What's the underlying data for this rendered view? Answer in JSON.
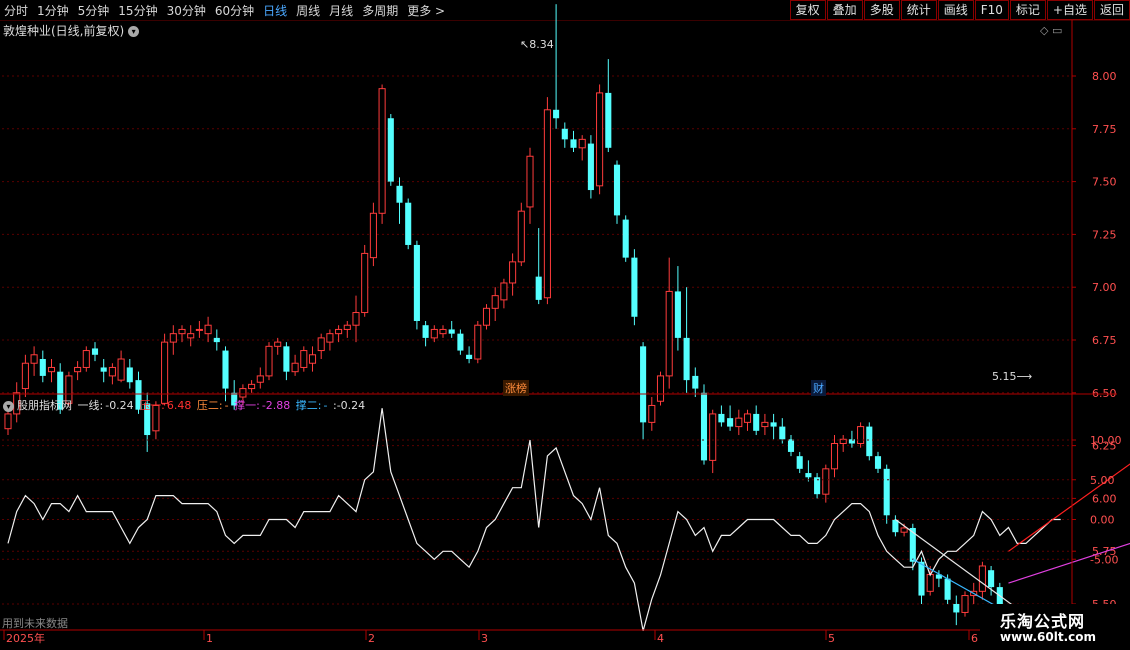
{
  "toolbar": {
    "periods": [
      "分时",
      "1分钟",
      "5分钟",
      "15分钟",
      "30分钟",
      "60分钟",
      "日线",
      "周线",
      "月线",
      "多周期",
      "更多 >"
    ],
    "active_period": "日线",
    "buttons": [
      "复权",
      "叠加",
      "多股",
      "统计",
      "画线",
      "F10",
      "标记",
      "+自选",
      "返回"
    ]
  },
  "main_chart": {
    "title": "敦煌种业(日线,前复权)",
    "high_marker": "8.34",
    "low_marker": "5.15",
    "badge_zhangbang": "涨榜",
    "badge_cai": "财",
    "y_ticks": [
      "8.00",
      "7.75",
      "7.50",
      "7.25",
      "7.00",
      "6.75",
      "6.50",
      "6.25",
      "6.00",
      "5.75",
      "5.50"
    ]
  },
  "indicator": {
    "name": "股朋指标网",
    "line1_label": "一线:",
    "line1_value": "-0.24",
    "ya1_label": "压一:",
    "ya1_value": "6.48",
    "ya2_label": "压二:",
    "ya2_value": "-",
    "cheng1_label": "撑一:",
    "cheng1_value": "-2.88",
    "cheng2_label": "撑二:",
    "cheng2_value": "-",
    "tail_value": ":-0.24",
    "y_ticks": [
      "10.00",
      "5.00",
      "0.00",
      "-5.00"
    ]
  },
  "time_axis": {
    "labels": [
      "2025年",
      "1",
      "2",
      "3",
      "4",
      "5",
      "6"
    ]
  },
  "footer_note": "用到未来数据",
  "watermark": {
    "line1": "乐淘公式网",
    "line2": "www.60lt.com"
  },
  "colors": {
    "up": "#ff3c3c",
    "down": "#54ffff",
    "axis": "#b00000",
    "active": "#4aa8ff"
  },
  "chart_data": {
    "type": "candlestick",
    "price_ylim": [
      5.15,
      8.34
    ],
    "indicator_ylim": [
      -12,
      14
    ],
    "candles": [
      [
        6.33,
        6.42,
        6.3,
        6.4
      ],
      [
        6.4,
        6.55,
        6.36,
        6.5
      ],
      [
        6.52,
        6.68,
        6.48,
        6.64
      ],
      [
        6.64,
        6.72,
        6.58,
        6.68
      ],
      [
        6.66,
        6.7,
        6.55,
        6.58
      ],
      [
        6.6,
        6.66,
        6.55,
        6.62
      ],
      [
        6.6,
        6.64,
        6.4,
        6.42
      ],
      [
        6.45,
        6.6,
        6.44,
        6.58
      ],
      [
        6.6,
        6.65,
        6.56,
        6.62
      ],
      [
        6.62,
        6.72,
        6.6,
        6.7
      ],
      [
        6.71,
        6.74,
        6.65,
        6.68
      ],
      [
        6.62,
        6.66,
        6.55,
        6.6
      ],
      [
        6.58,
        6.64,
        6.54,
        6.62
      ],
      [
        6.56,
        6.7,
        6.55,
        6.66
      ],
      [
        6.62,
        6.66,
        6.52,
        6.55
      ],
      [
        6.56,
        6.6,
        6.4,
        6.42
      ],
      [
        6.45,
        6.5,
        6.22,
        6.3
      ],
      [
        6.32,
        6.46,
        6.28,
        6.44
      ],
      [
        6.45,
        6.78,
        6.44,
        6.74
      ],
      [
        6.74,
        6.82,
        6.68,
        6.78
      ],
      [
        6.78,
        6.82,
        6.74,
        6.8
      ],
      [
        6.76,
        6.82,
        6.72,
        6.78
      ],
      [
        6.8,
        6.84,
        6.76,
        6.8
      ],
      [
        6.78,
        6.86,
        6.74,
        6.82
      ],
      [
        6.76,
        6.8,
        6.7,
        6.74
      ],
      [
        6.7,
        6.72,
        6.46,
        6.52
      ],
      [
        6.5,
        6.56,
        6.42,
        6.44
      ],
      [
        6.48,
        6.54,
        6.44,
        6.52
      ],
      [
        6.52,
        6.56,
        6.5,
        6.54
      ],
      [
        6.55,
        6.62,
        6.52,
        6.58
      ],
      [
        6.58,
        6.74,
        6.56,
        6.72
      ],
      [
        6.72,
        6.76,
        6.68,
        6.74
      ],
      [
        6.72,
        6.74,
        6.56,
        6.6
      ],
      [
        6.6,
        6.68,
        6.58,
        6.64
      ],
      [
        6.62,
        6.72,
        6.6,
        6.7
      ],
      [
        6.64,
        6.72,
        6.6,
        6.68
      ],
      [
        6.7,
        6.78,
        6.66,
        6.76
      ],
      [
        6.74,
        6.8,
        6.7,
        6.78
      ],
      [
        6.78,
        6.82,
        6.74,
        6.8
      ],
      [
        6.8,
        6.84,
        6.76,
        6.82
      ],
      [
        6.82,
        6.96,
        6.74,
        6.88
      ],
      [
        6.88,
        7.2,
        6.86,
        7.16
      ],
      [
        7.14,
        7.4,
        7.1,
        7.35
      ],
      [
        7.35,
        7.96,
        7.3,
        7.94
      ],
      [
        7.8,
        7.82,
        7.48,
        7.5
      ],
      [
        7.48,
        7.52,
        7.3,
        7.4
      ],
      [
        7.4,
        7.42,
        7.18,
        7.2
      ],
      [
        7.2,
        7.22,
        6.8,
        6.84
      ],
      [
        6.82,
        6.84,
        6.72,
        6.76
      ],
      [
        6.76,
        6.82,
        6.74,
        6.8
      ],
      [
        6.78,
        6.82,
        6.76,
        6.8
      ],
      [
        6.8,
        6.84,
        6.76,
        6.78
      ],
      [
        6.78,
        6.8,
        6.68,
        6.7
      ],
      [
        6.68,
        6.72,
        6.64,
        6.66
      ],
      [
        6.66,
        6.84,
        6.64,
        6.82
      ],
      [
        6.82,
        6.92,
        6.8,
        6.9
      ],
      [
        6.9,
        7.0,
        6.84,
        6.96
      ],
      [
        6.94,
        7.04,
        6.9,
        7.02
      ],
      [
        7.02,
        7.16,
        6.96,
        7.12
      ],
      [
        7.12,
        7.4,
        7.1,
        7.36
      ],
      [
        7.38,
        7.66,
        7.3,
        7.62
      ],
      [
        7.05,
        7.28,
        6.92,
        6.94
      ],
      [
        6.95,
        7.9,
        6.92,
        7.84
      ],
      [
        7.84,
        8.34,
        7.75,
        7.8
      ],
      [
        7.75,
        7.78,
        7.66,
        7.7
      ],
      [
        7.7,
        7.74,
        7.64,
        7.66
      ],
      [
        7.66,
        7.72,
        7.6,
        7.7
      ],
      [
        7.68,
        7.72,
        7.42,
        7.46
      ],
      [
        7.48,
        7.96,
        7.44,
        7.92
      ],
      [
        7.92,
        8.08,
        7.64,
        7.66
      ],
      [
        7.58,
        7.6,
        7.3,
        7.34
      ],
      [
        7.32,
        7.34,
        7.12,
        7.14
      ],
      [
        7.14,
        7.18,
        6.82,
        6.86
      ],
      [
        6.72,
        6.74,
        6.28,
        6.36
      ],
      [
        6.36,
        6.48,
        6.32,
        6.44
      ],
      [
        6.46,
        6.6,
        6.44,
        6.58
      ],
      [
        6.58,
        7.14,
        6.52,
        6.98
      ],
      [
        6.98,
        7.1,
        6.7,
        6.76
      ],
      [
        6.76,
        7.0,
        6.5,
        6.56
      ],
      [
        6.58,
        6.62,
        6.48,
        6.52
      ],
      [
        6.5,
        6.54,
        6.16,
        6.18
      ],
      [
        6.18,
        6.42,
        6.12,
        6.4
      ],
      [
        6.4,
        6.44,
        6.34,
        6.36
      ],
      [
        6.38,
        6.44,
        6.32,
        6.34
      ],
      [
        6.34,
        6.42,
        6.3,
        6.38
      ],
      [
        6.36,
        6.42,
        6.32,
        6.4
      ],
      [
        6.4,
        6.44,
        6.3,
        6.32
      ],
      [
        6.34,
        6.4,
        6.3,
        6.36
      ],
      [
        6.36,
        6.4,
        6.28,
        6.34
      ],
      [
        6.34,
        6.38,
        6.26,
        6.28
      ],
      [
        6.28,
        6.3,
        6.2,
        6.22
      ],
      [
        6.2,
        6.22,
        6.12,
        6.14
      ],
      [
        6.12,
        6.18,
        6.08,
        6.1
      ],
      [
        6.1,
        6.12,
        6.0,
        6.02
      ],
      [
        6.02,
        6.16,
        5.98,
        6.14
      ],
      [
        6.14,
        6.3,
        6.1,
        6.26
      ],
      [
        6.26,
        6.3,
        6.22,
        6.28
      ],
      [
        6.28,
        6.32,
        6.24,
        6.26
      ],
      [
        6.26,
        6.36,
        6.24,
        6.34
      ],
      [
        6.34,
        6.36,
        6.18,
        6.2
      ],
      [
        6.2,
        6.22,
        6.12,
        6.14
      ],
      [
        6.14,
        6.16,
        5.88,
        5.92
      ],
      [
        5.9,
        5.92,
        5.82,
        5.84
      ],
      [
        5.84,
        5.88,
        5.82,
        5.86
      ],
      [
        5.86,
        5.88,
        5.66,
        5.7
      ],
      [
        5.7,
        5.72,
        5.5,
        5.54
      ],
      [
        5.56,
        5.68,
        5.54,
        5.64
      ],
      [
        5.64,
        5.66,
        5.58,
        5.62
      ],
      [
        5.62,
        5.64,
        5.5,
        5.52
      ],
      [
        5.5,
        5.54,
        5.4,
        5.46
      ],
      [
        5.46,
        5.56,
        5.44,
        5.54
      ],
      [
        5.54,
        5.6,
        5.5,
        5.56
      ],
      [
        5.56,
        5.7,
        5.52,
        5.68
      ],
      [
        5.66,
        5.68,
        5.54,
        5.58
      ],
      [
        5.58,
        5.6,
        5.48,
        5.5
      ],
      [
        5.48,
        5.5,
        5.4,
        5.42
      ],
      [
        5.42,
        5.44,
        5.34,
        5.36
      ],
      [
        5.36,
        5.38,
        5.3,
        5.32
      ],
      [
        5.3,
        5.36,
        5.15,
        5.32
      ],
      [
        5.32,
        5.42,
        5.28,
        5.4
      ],
      [
        5.4,
        5.48,
        5.36,
        5.46
      ]
    ],
    "indicator_line": [
      -3,
      1,
      3,
      2,
      0,
      2,
      2,
      1,
      3,
      1,
      1,
      1,
      1,
      -1,
      -3,
      -1,
      0,
      3,
      3,
      3,
      2,
      2,
      2,
      2,
      1,
      -2,
      -3,
      -2,
      -2,
      -2,
      0,
      0,
      0,
      -1,
      1,
      1,
      1,
      1,
      3,
      2,
      1,
      5,
      6,
      14,
      6,
      3,
      0,
      -3,
      -4,
      -5,
      -4,
      -4,
      -5,
      -6,
      -4,
      -1,
      0,
      2,
      4,
      4,
      10,
      -1,
      8,
      9,
      6,
      3,
      2,
      0,
      4,
      -2,
      -3,
      -6,
      -8,
      -14,
      -10,
      -7,
      -3,
      1,
      0,
      -2,
      -1,
      -4,
      -2,
      -2,
      -1,
      0,
      0,
      0,
      0,
      -1,
      -2,
      -2,
      -3,
      -3,
      -2,
      0,
      1,
      2,
      2,
      1,
      -2,
      -4,
      -5,
      -6,
      -6,
      -4,
      -7,
      -5,
      -4,
      -4,
      -3,
      -2,
      1,
      0,
      -2,
      -1,
      -3,
      -3,
      -2,
      -1,
      0,
      0
    ],
    "trend_lines": [
      {
        "name": "压一",
        "color": "#ff2020",
        "from": [
          115,
          -4
        ],
        "to": [
          129,
          7
        ]
      },
      {
        "name": "撑一",
        "color": "#e040e0",
        "from": [
          115,
          -8
        ],
        "to": [
          129,
          -3
        ]
      },
      {
        "name": "line-a",
        "color": "#e6e6e6",
        "from": [
          102,
          0
        ],
        "to": [
          117,
          -12
        ]
      },
      {
        "name": "line-b",
        "color": "#3ab8ff",
        "from": [
          104,
          -5
        ],
        "to": [
          117,
          -13
        ]
      }
    ]
  }
}
